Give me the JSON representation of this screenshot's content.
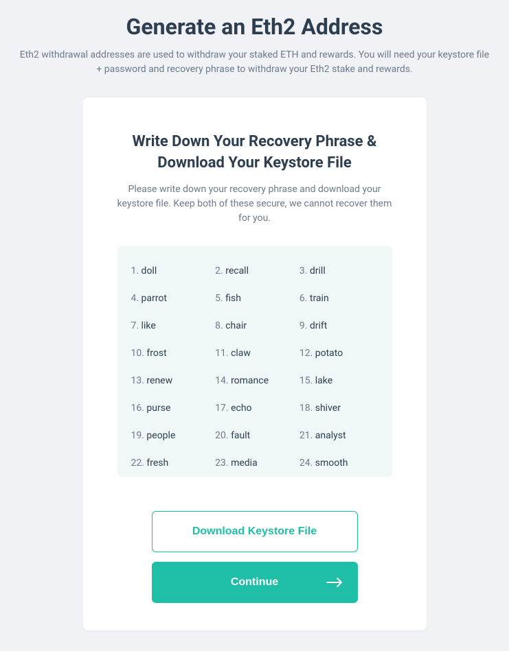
{
  "header": {
    "title": "Generate an Eth2 Address",
    "subtitle": "Eth2 withdrawal addresses are used to withdraw your staked ETH and rewards. You will need your keystore file + password and recovery phrase to withdraw your Eth2 stake and rewards."
  },
  "card": {
    "title": "Write Down Your Recovery Phrase & Download Your Keystore File",
    "description": "Please write down your recovery phrase and download your keystore file. Keep both of these secure, we cannot recover them for you."
  },
  "phrase": {
    "words": [
      "doll",
      "recall",
      "drill",
      "parrot",
      "fish",
      "train",
      "like",
      "chair",
      "drift",
      "frost",
      "claw",
      "potato",
      "renew",
      "romance",
      "lake",
      "purse",
      "echo",
      "shiver",
      "people",
      "fault",
      "analyst",
      "fresh",
      "media",
      "smooth"
    ]
  },
  "buttons": {
    "download_label": "Download Keystore File",
    "continue_label": "Continue"
  },
  "colors": {
    "teal": "#1fbfa7",
    "phrase_bg": "#f0f8f7",
    "page_bg": "#f0f2f5"
  }
}
